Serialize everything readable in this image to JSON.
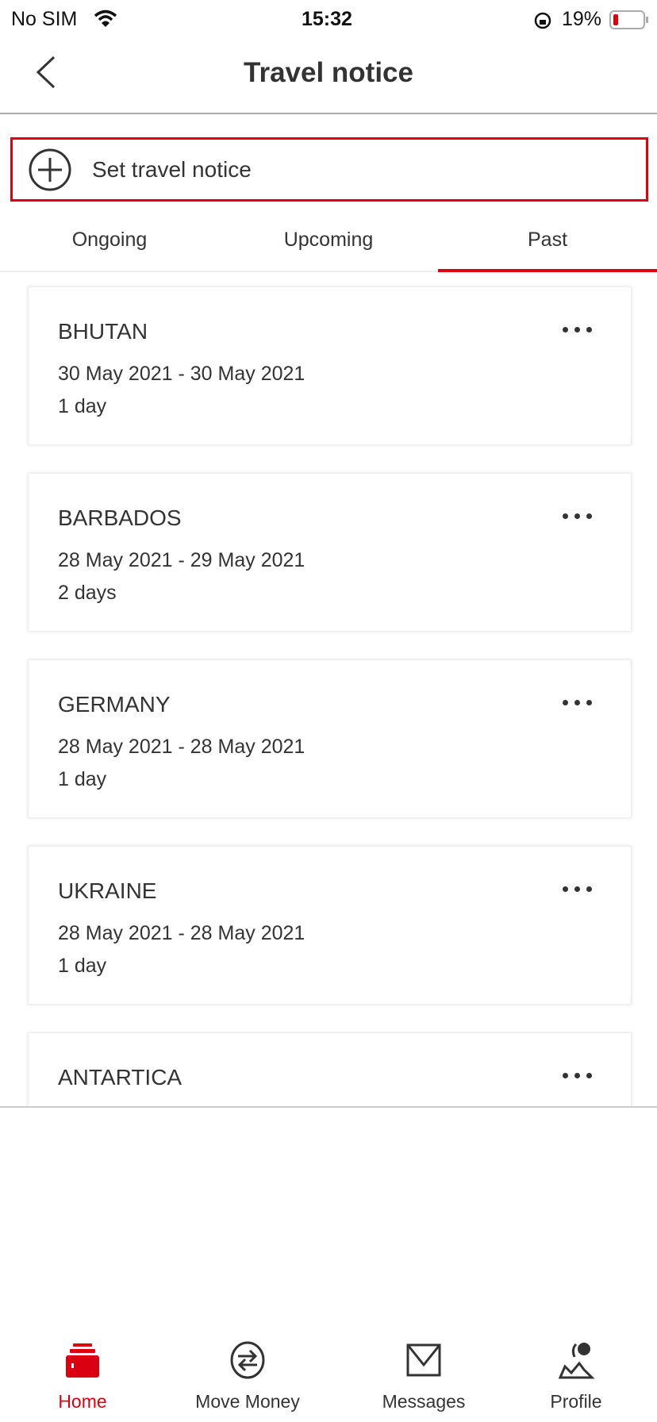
{
  "status_bar": {
    "carrier": "No SIM",
    "time": "15:32",
    "battery": "19%"
  },
  "header": {
    "title": "Travel notice",
    "back_icon": "chevron-left-icon"
  },
  "set_notice": {
    "label": "Set travel notice",
    "icon": "plus-circle-icon",
    "border_color": "#e0000b"
  },
  "tabs": [
    {
      "label": "Ongoing"
    },
    {
      "label": "Upcoming"
    },
    {
      "label": "Past",
      "active": true
    }
  ],
  "accent": "#db0011",
  "notices": [
    {
      "country": "BHUTAN",
      "dates": "30 May 2021 - 30 May 2021",
      "duration": "1 day"
    },
    {
      "country": "BARBADOS",
      "dates": "28 May 2021 - 29 May 2021",
      "duration": "2 days"
    },
    {
      "country": "GERMANY",
      "dates": "28 May 2021 - 28 May 2021",
      "duration": "1 day"
    },
    {
      "country": "UKRAINE",
      "dates": "28 May 2021 - 28 May 2021",
      "duration": "1 day"
    },
    {
      "country": "ANTARTICA"
    }
  ],
  "bottom_nav": [
    {
      "label": "Home",
      "icon": "home-icon",
      "active": true
    },
    {
      "label": "Move Money",
      "icon": "transfer-icon"
    },
    {
      "label": "Messages",
      "icon": "envelope-icon"
    },
    {
      "label": "Profile",
      "icon": "profile-icon"
    }
  ]
}
